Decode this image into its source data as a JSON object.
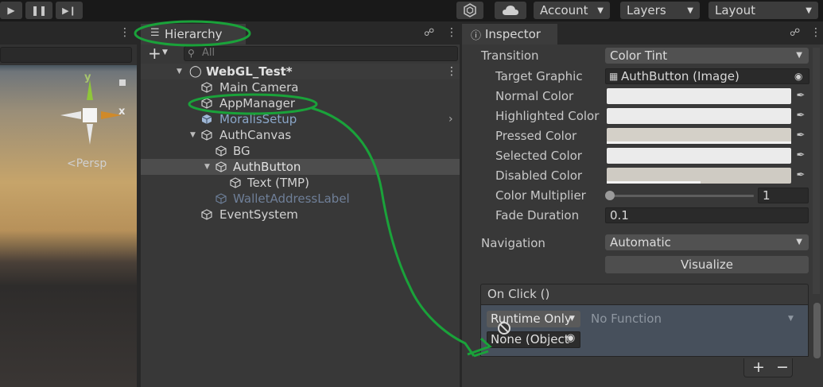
{
  "toolbar": {
    "account_label": "Account",
    "layers_label": "Layers",
    "layout_label": "Layout"
  },
  "scene": {
    "persp_label": "<Persp",
    "axis_y": "y",
    "axis_x": "x"
  },
  "hierarchy": {
    "tab_label": "Hierarchy",
    "search_placeholder": "All",
    "scene_name": "WebGL_Test*",
    "items": [
      {
        "label": "Main Camera"
      },
      {
        "label": "AppManager"
      },
      {
        "label": "MoralisSetup"
      },
      {
        "label": "AuthCanvas"
      },
      {
        "label": "BG"
      },
      {
        "label": "AuthButton"
      },
      {
        "label": "Text (TMP)"
      },
      {
        "label": "WalletAddressLabel"
      },
      {
        "label": "EventSystem"
      }
    ]
  },
  "inspector": {
    "tab_label": "Inspector",
    "transition_label": "Transition",
    "transition_value": "Color Tint",
    "target_graphic_label": "Target Graphic",
    "target_graphic_value": "AuthButton (Image)",
    "normal_color_label": "Normal Color",
    "highlighted_color_label": "Highlighted Color",
    "pressed_color_label": "Pressed Color",
    "selected_color_label": "Selected Color",
    "disabled_color_label": "Disabled Color",
    "color_multiplier_label": "Color Multiplier",
    "color_multiplier_value": "1",
    "fade_duration_label": "Fade Duration",
    "fade_duration_value": "0.1",
    "navigation_label": "Navigation",
    "navigation_value": "Automatic",
    "visualize_label": "Visualize",
    "onclick_header": "On Click ()",
    "runtime_value": "Runtime Only",
    "function_value": "No Function",
    "object_value": "None (Object",
    "add_label": "+",
    "remove_label": "−"
  },
  "colors": {
    "annotation_green": "#1aa23a",
    "selection_row": "#4d4d4d"
  }
}
